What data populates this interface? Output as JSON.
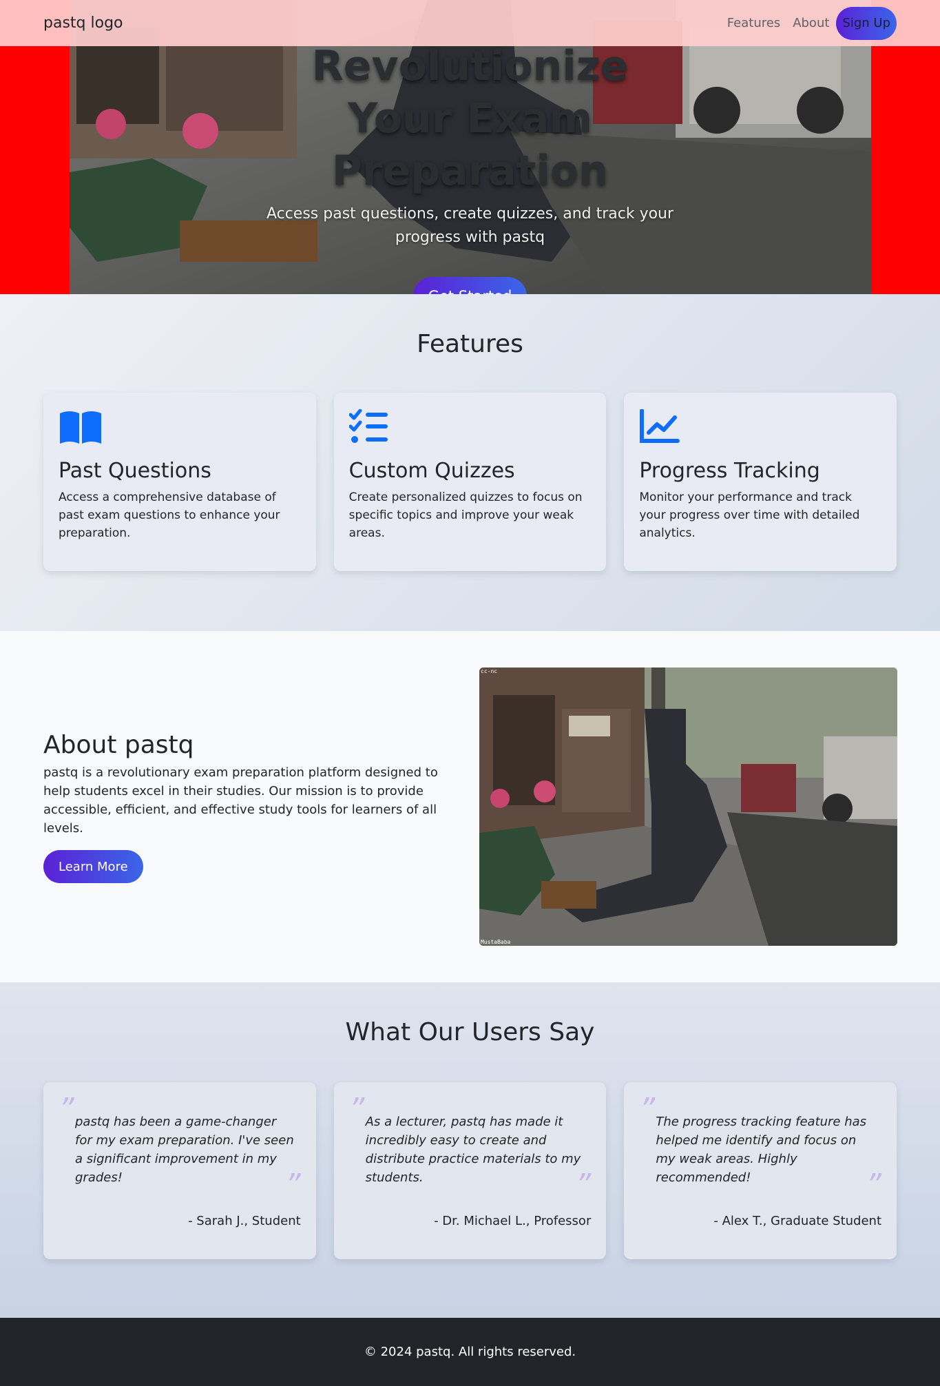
{
  "colors": {
    "navbar_bg": "#ffcece",
    "hero_bg": "#ff0000",
    "gradient_start": "#5b21d6",
    "gradient_end": "#3a66e8",
    "icon_blue": "#0d6efd",
    "footer_bg": "#212529"
  },
  "navbar": {
    "brand": "pastq logo",
    "links": [
      "Features",
      "About"
    ],
    "signup_label": "Sign Up"
  },
  "hero": {
    "title": "Revolutionize Your Exam Preparation",
    "subtitle": "Access past questions, create quizzes, and track your progress with pastq",
    "cta_label": "Get Started"
  },
  "features": {
    "title": "Features",
    "cards": [
      {
        "icon": "book-icon",
        "title": "Past Questions",
        "text": "Access a comprehensive database of past exam questions to enhance your preparation."
      },
      {
        "icon": "checklist-icon",
        "title": "Custom Quizzes",
        "text": "Create personalized quizzes to focus on specific topics and improve your weak areas."
      },
      {
        "icon": "line-chart-icon",
        "title": "Progress Tracking",
        "text": "Monitor your performance and track your progress over time with detailed analytics."
      }
    ]
  },
  "about": {
    "title": "About pastq",
    "body": "pastq is a revolutionary exam preparation platform designed to help students excel in their studies. Our mission is to provide accessible, efficient, and effective study tools for learners of all levels.",
    "cta_label": "Learn More",
    "image_credit_top": "cc-nc",
    "image_credit_bottom": "MustaBaba"
  },
  "testimonials": {
    "title": "What Our Users Say",
    "quote_mark_open": "”",
    "quote_mark_close": "”",
    "items": [
      {
        "quote": "pastq has been a game-changer for my exam preparation. I've seen a significant improvement in my grades!",
        "author": "- Sarah J., Student"
      },
      {
        "quote": "As a lecturer, pastq has made it incredibly easy to create and distribute practice materials to my students.",
        "author": "- Dr. Michael L., Professor"
      },
      {
        "quote": "The progress tracking feature has helped me identify and focus on my weak areas. Highly recommended!",
        "author": "- Alex T., Graduate Student"
      }
    ]
  },
  "footer": {
    "text": "© 2024 pastq. All rights reserved."
  }
}
